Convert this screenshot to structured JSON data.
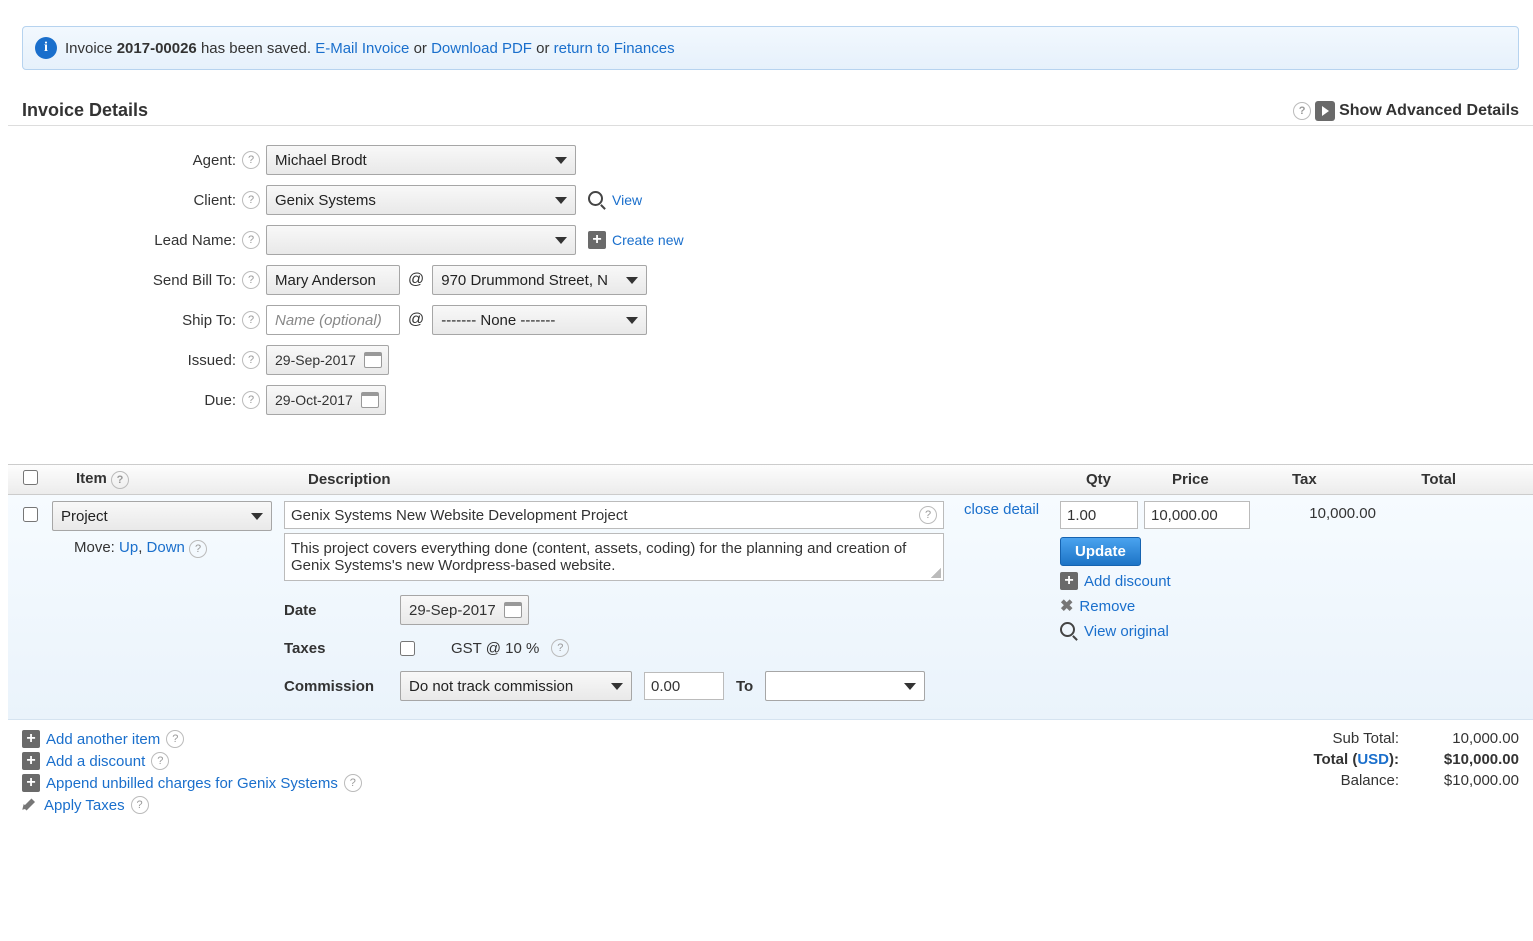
{
  "banner": {
    "prefix": "Invoice ",
    "invoice_no": "2017-00026",
    "saved_text": " has been saved. ",
    "email_link": "E-Mail Invoice",
    "or1": " or ",
    "download_link": "Download PDF",
    "or2": " or ",
    "return_link": "return to Finances"
  },
  "section": {
    "title": "Invoice Details",
    "advanced": "Show Advanced Details"
  },
  "fields": {
    "agent_label": "Agent:",
    "agent_value": "Michael Brodt",
    "client_label": "Client:",
    "client_value": "Genix Systems",
    "view_link": "View",
    "lead_label": "Lead Name:",
    "lead_value": "",
    "create_new": "Create new",
    "sendbill_label": "Send Bill To:",
    "bill_name": "Mary Anderson",
    "bill_addr": "970 Drummond Street, N",
    "shipto_label": "Ship To:",
    "ship_name_placeholder": "Name (optional)",
    "ship_addr": "------- None -------",
    "issued_label": "Issued:",
    "issued_value": "29-Sep-2017",
    "due_label": "Due:",
    "due_value": "29-Oct-2017"
  },
  "thead": {
    "item": "Item",
    "desc": "Description",
    "qty": "Qty",
    "price": "Price",
    "tax": "Tax",
    "total": "Total"
  },
  "line": {
    "item_type": "Project",
    "close_detail": "close detail",
    "move_label": "Move: ",
    "up": "Up",
    "down": "Down",
    "title": "Genix Systems New Website Development Project",
    "body": "This project covers everything done (content, assets, coding) for the planning and creation of Genix Systems's new Wordpress-based website.",
    "date_label": "Date",
    "date_value": "29-Sep-2017",
    "taxes_label": "Taxes",
    "tax_name": "GST @ 10 %",
    "commission_label": "Commission",
    "commission_mode": "Do not track commission",
    "commission_amt": "0.00",
    "commission_to": "To",
    "qty": "1.00",
    "price": "10,000.00",
    "total": "10,000.00",
    "update_btn": "Update",
    "add_discount": "Add discount",
    "remove": "Remove",
    "view_original": "View original"
  },
  "foot": {
    "add_item": "Add another item",
    "add_discount": "Add a discount",
    "append": "Append unbilled charges for Genix Systems",
    "apply_taxes": "Apply Taxes",
    "subtotal_label": "Sub Total:",
    "subtotal": "10,000.00",
    "total_label_pre": "Total (",
    "currency": "USD",
    "total_label_post": "):",
    "total": "$10,000.00",
    "balance_label": "Balance:",
    "balance": "$10,000.00"
  }
}
